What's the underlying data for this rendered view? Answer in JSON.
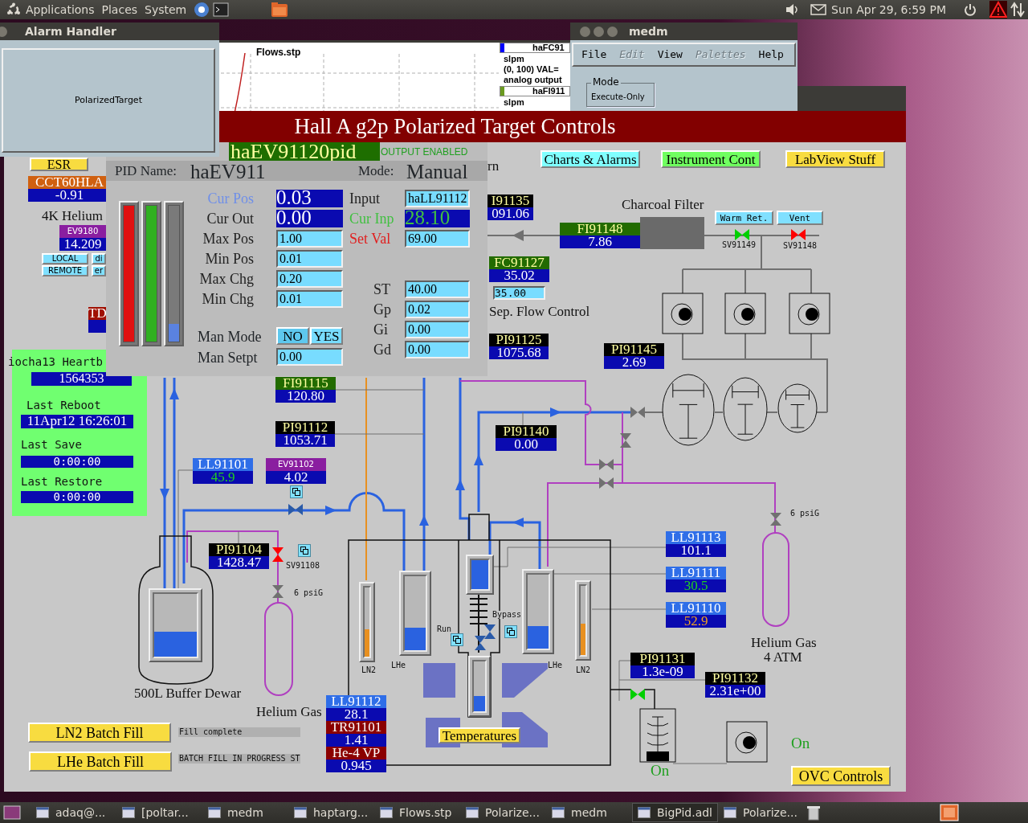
{
  "top_panel": {
    "menus": [
      "Applications",
      "Places",
      "System"
    ],
    "clock": "Sun Apr 29, 6:59 PM"
  },
  "alarm_handler": {
    "title": "Alarm Handler",
    "button": "PolarizedTarget"
  },
  "flows_window": {
    "title": "Flows.stp",
    "series": [
      {
        "name": "haFC91",
        "color": "#0000ff",
        "lines": [
          "slpm",
          "(0, 100) VAL=",
          "analog output"
        ]
      },
      {
        "name": "haFI911",
        "color": "#6a9a20",
        "lines": [
          "slpm"
        ]
      }
    ]
  },
  "medm_window": {
    "title": "medm",
    "menu": [
      {
        "label": "File",
        "disabled": false
      },
      {
        "label": "Edit",
        "disabled": true
      },
      {
        "label": "View",
        "disabled": false
      },
      {
        "label": "Palettes",
        "disabled": true
      },
      {
        "label": "Help",
        "disabled": false
      }
    ],
    "mode_label": "Mode",
    "mode_value": "Execute-Only"
  },
  "main_window": {
    "title": "Hall A g2p Polarized Target Controls",
    "buttons": [
      {
        "label": "ESR",
        "color": "#f8dc40"
      },
      {
        "label": "LOCAL",
        "color": "#80e0ff"
      },
      {
        "label": "REMOTE",
        "color": "#80e0ff"
      },
      {
        "label": "di",
        "color": "#80e0ff"
      },
      {
        "label": "er",
        "color": "#80e0ff"
      },
      {
        "label": "Charts & Alarms",
        "color": "#80ffff"
      },
      {
        "label": "Instrument Cont",
        "color": "#70ff60"
      },
      {
        "label": "LabView Stuff",
        "color": "#f8dc40"
      },
      {
        "label": "Warm Ret.",
        "color": "#80e0ff"
      },
      {
        "label": "Vent",
        "color": "#80e0ff"
      },
      {
        "label": "LN2 Batch Fill",
        "color": "#f8dc40"
      },
      {
        "label": "LHe Batch Fill",
        "color": "#f8dc40"
      },
      {
        "label": "Temperatures",
        "color": "#f8dc40"
      },
      {
        "label": "OVC Controls",
        "color": "#f8dc40"
      }
    ],
    "readouts": [
      {
        "label": "CCT60HLA",
        "value": "-0.91",
        "color": "#d06010",
        "kind": "plain"
      },
      {
        "label": "EV9180",
        "value": "14.209",
        "color": "#8a1ea0",
        "kind": "plain"
      },
      {
        "label": "TD",
        "color": "#a01000",
        "kind": "plain"
      },
      {
        "label": "I91135",
        "value": "091.06",
        "color": "#000000",
        "kind": "plain"
      },
      {
        "label": "FI91148",
        "value": "7.86",
        "color": "#226b00",
        "kind": "plain"
      },
      {
        "label": "FC91127",
        "value": "35.02",
        "color": "#226b00",
        "kind": "plain"
      },
      {
        "label": "PI91125",
        "value": "1075.68",
        "color": "#000000",
        "kind": "plain"
      },
      {
        "label": "PI91145",
        "value": "2.69",
        "color": "#000000",
        "kind": "plain"
      },
      {
        "label": "FI91115",
        "value": "120.80",
        "color": "#226b00",
        "kind": "plain"
      },
      {
        "label": "PI91112",
        "value": "1053.71",
        "color": "#000000",
        "kind": "plain"
      },
      {
        "label": "PI91140",
        "value": "0.00",
        "color": "#000000",
        "kind": "plain"
      },
      {
        "label": "LL91101",
        "value": "45.9",
        "color": "#2f6ee8",
        "kind": "ok"
      },
      {
        "label": "EV91102",
        "value": "4.02",
        "color": "#8a1ea0",
        "kind": "plain"
      },
      {
        "label": "LL91113",
        "value": "101.1",
        "color": "#2f6ee8",
        "kind": "plain"
      },
      {
        "label": "PI91104",
        "value": "1428.47",
        "color": "#000000",
        "kind": "plain"
      },
      {
        "label": "LL91111",
        "value": "30.5",
        "color": "#2f6ee8",
        "kind": "ok"
      },
      {
        "label": "LL91110",
        "value": "52.9",
        "color": "#2f6ee8",
        "kind": "minor"
      },
      {
        "label": "PI91131",
        "value": "1.3e-09",
        "color": "#000000",
        "kind": "plain"
      },
      {
        "label": "PI91132",
        "value": "2.31e+00",
        "color": "#000000",
        "kind": "plain"
      },
      {
        "label": "LL91112",
        "value": "28.1",
        "color": "#2f6ee8",
        "kind": "plain"
      },
      {
        "label": "TR91101",
        "value": "1.41",
        "color": "#8b0000",
        "kind": "plain"
      },
      {
        "label": "He-4 VP",
        "value": "0.945",
        "color": "#8b0000",
        "kind": "plain"
      }
    ],
    "labels": [
      {
        "text": "4K Helium",
        "kind": "caption"
      },
      {
        "text": "rn",
        "kind": "caption"
      },
      {
        "text": "Charcoal Filter",
        "kind": "caption"
      },
      {
        "text": "Sep. Flow Control",
        "kind": "caption"
      },
      {
        "text": "500L Buffer Dewar",
        "kind": "caption"
      },
      {
        "text": "Helium Gas",
        "kind": "caption"
      },
      {
        "text": "Helium Gas",
        "kind": "caption"
      },
      {
        "text": "4 ATM",
        "kind": "caption"
      },
      {
        "text": "SV91149",
        "kind": "small"
      },
      {
        "text": "SV91148",
        "kind": "small"
      },
      {
        "text": "SV91108",
        "kind": "small"
      },
      {
        "text": "6 psiG",
        "kind": "small"
      },
      {
        "text": "6 psiG",
        "kind": "small"
      },
      {
        "text": "LN2",
        "kind": "small"
      },
      {
        "text": "LHe",
        "kind": "small"
      },
      {
        "text": "Run",
        "kind": "small"
      },
      {
        "text": "Bypass",
        "kind": "small"
      },
      {
        "text": "LHe",
        "kind": "small"
      },
      {
        "text": "LN2",
        "kind": "small"
      },
      {
        "text": "On",
        "kind": "status"
      },
      {
        "text": "On",
        "kind": "status"
      }
    ],
    "status_fields": [
      "Fill complete",
      "BATCH FILL IN PROGRESS ST"
    ],
    "flow_setpoint": "35.00",
    "heartbeat": {
      "title": "iocha13 Heartb",
      "count": "1564353",
      "rows": [
        {
          "label": "Last Reboot",
          "value": "11Apr12 16:26:01"
        },
        {
          "label": "Last Save",
          "value": "0:00:00"
        },
        {
          "label": "Last Restore",
          "value": "0:00:00"
        }
      ]
    },
    "tanks": [
      {
        "level": 0.4,
        "color": "#2a62e0"
      },
      {
        "level": 0.4,
        "color": "#e89020"
      },
      {
        "level": 0.3,
        "color": "#2a62e0"
      },
      {
        "level": 1,
        "color": "#2a62e0"
      },
      {
        "level": 0.3,
        "color": "#2a62e0"
      },
      {
        "level": 0.3,
        "color": "#2a62e0"
      },
      {
        "level": 0.45,
        "color": "#e89020"
      }
    ],
    "valves": [
      {
        "color": "#00d000"
      },
      {
        "color": "#ff0000"
      },
      {
        "color": "#ff0000"
      },
      {
        "color": "#2a5aa8"
      },
      {
        "color": "#2a5aa8"
      },
      {
        "color": "#2a5aa8"
      },
      {
        "color": "#707070"
      },
      {
        "color": "#707070"
      },
      {
        "color": "#707070"
      },
      {
        "color": "#707070"
      },
      {
        "color": "#00d000"
      }
    ]
  },
  "pid_window": {
    "title": "haEV91120pid",
    "status": "OUTPUT ENABLED",
    "name_label": "PID Name:",
    "name": "haEV911",
    "mode_label": "Mode:",
    "mode": "Manual",
    "bars": [
      {
        "color": "#e01010",
        "level": 1
      },
      {
        "color": "#30b020",
        "level": 1
      },
      {
        "color": "#5a82e0",
        "level": 0.13
      }
    ],
    "left_fields": [
      {
        "label": "Cur Pos",
        "value": "0.03",
        "kind": "readout",
        "color": "#6f8fe8"
      },
      {
        "label": "Cur Out",
        "value": "0.00",
        "kind": "readout",
        "color": "#222222"
      },
      {
        "label": "Max Pos",
        "value": "1.00",
        "kind": "entry",
        "color": "#222222"
      },
      {
        "label": "Min Pos",
        "value": "0.01",
        "kind": "entry",
        "color": "#222222"
      },
      {
        "label": "Max Chg",
        "value": "0.20",
        "kind": "entry",
        "color": "#222222"
      },
      {
        "label": "Min Chg",
        "value": "0.01",
        "kind": "entry",
        "color": "#222222"
      }
    ],
    "man_mode": {
      "label": "Man Mode",
      "options": [
        {
          "label": "NO",
          "selected": true
        },
        {
          "label": "YES",
          "selected": false
        }
      ]
    },
    "man_setpt": {
      "label": "Man Setpt",
      "value": "0.00"
    },
    "right_fields": [
      {
        "label": "Input",
        "value": "haLL91112",
        "kind": "entry",
        "color": "#222222"
      },
      {
        "label": "Cur Inp",
        "value": "28.10",
        "kind": "readout",
        "color": "#40c040"
      },
      {
        "label": "Set Val",
        "value": "69.00",
        "kind": "entry",
        "color": "#e02020"
      },
      {
        "label": "ST",
        "value": "40.00",
        "kind": "entry",
        "color": "#222222"
      },
      {
        "label": "Gp",
        "value": "0.02",
        "kind": "entry",
        "color": "#222222"
      },
      {
        "label": "Gi",
        "value": "0.00",
        "kind": "entry",
        "color": "#222222"
      },
      {
        "label": "Gd",
        "value": "0.00",
        "kind": "entry",
        "color": "#222222"
      }
    ]
  },
  "taskbar": [
    {
      "label": "adaq@...",
      "selected": false
    },
    {
      "label": "[poltar...",
      "selected": false
    },
    {
      "label": "medm",
      "selected": false
    },
    {
      "label": "haptarg...",
      "selected": false
    },
    {
      "label": "Flows.stp",
      "selected": false
    },
    {
      "label": "Polarize...",
      "selected": false
    },
    {
      "label": "medm",
      "selected": false
    },
    {
      "label": "BigPid.adl",
      "selected": true
    },
    {
      "label": "Polarize...",
      "selected": false
    }
  ]
}
